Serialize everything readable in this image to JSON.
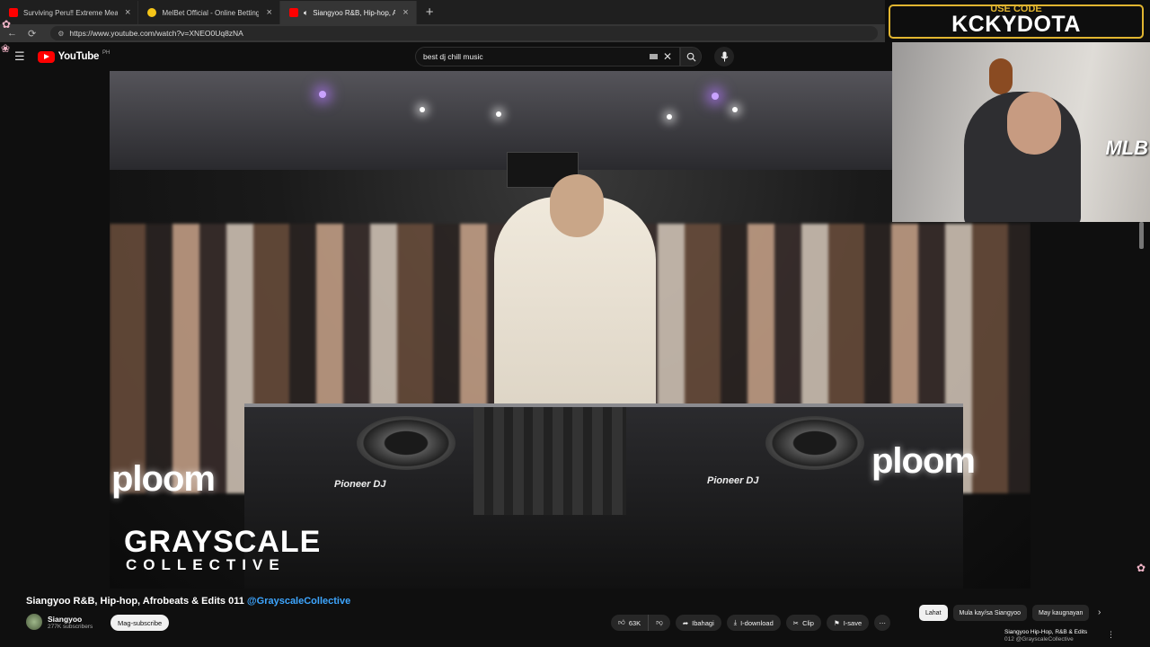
{
  "browser": {
    "tabs": [
      {
        "title": "Surviving Peru‼ Extreme Meats ft",
        "favicon_color": "#ff0000",
        "active": false
      },
      {
        "title": "MelBet Official - Online Betting W",
        "favicon_color": "#f5c518",
        "active": false
      },
      {
        "title": "Siangyoo R&B, Hip-hop, Afro",
        "favicon_color": "#ff0000",
        "active": true
      }
    ],
    "new_tab_label": "+",
    "url": "https://www.youtube.com/watch?v=XNEO0Uq8zNA"
  },
  "youtube": {
    "logo_word": "YouTube",
    "logo_country": "PH",
    "search_query": "best dj chill music"
  },
  "video": {
    "overlay_brand_main": "GRAYSCALE",
    "overlay_brand_sub": "COLLECTIVE",
    "deck_brand": "Pioneer DJ",
    "sponsor": "ploom"
  },
  "stream_overlay": {
    "promo_top": "USE CODE",
    "promo_code": "KCKYDOTA",
    "webcam_badge": "MLB"
  },
  "watch": {
    "title": "Siangyoo R&B, Hip-hop, Afrobeats & Edits 011",
    "title_tag": "@GrayscaleCollective",
    "channel_name": "Siangyoo",
    "channel_subs": "277K subscribers",
    "subscribe_label": "Mag-subscribe",
    "actions": {
      "likes": "63K",
      "share": "Ibahagi",
      "download": "I-download",
      "clip": "Clip",
      "save": "I-save"
    }
  },
  "sidebar": {
    "chips": [
      "Lahat",
      "Mula kay/sa Siangyoo",
      "May kaugnayan"
    ],
    "next_video_title": "Siangyoo Hip-Hop, R&B & Edits",
    "next_video_sub": "012 @GrayscaleCollective"
  },
  "colors": {
    "yt_red": "#ff0000",
    "promo_gold": "#e1b530",
    "link_blue": "#3ea6ff",
    "bg": "#0f0f0f"
  }
}
